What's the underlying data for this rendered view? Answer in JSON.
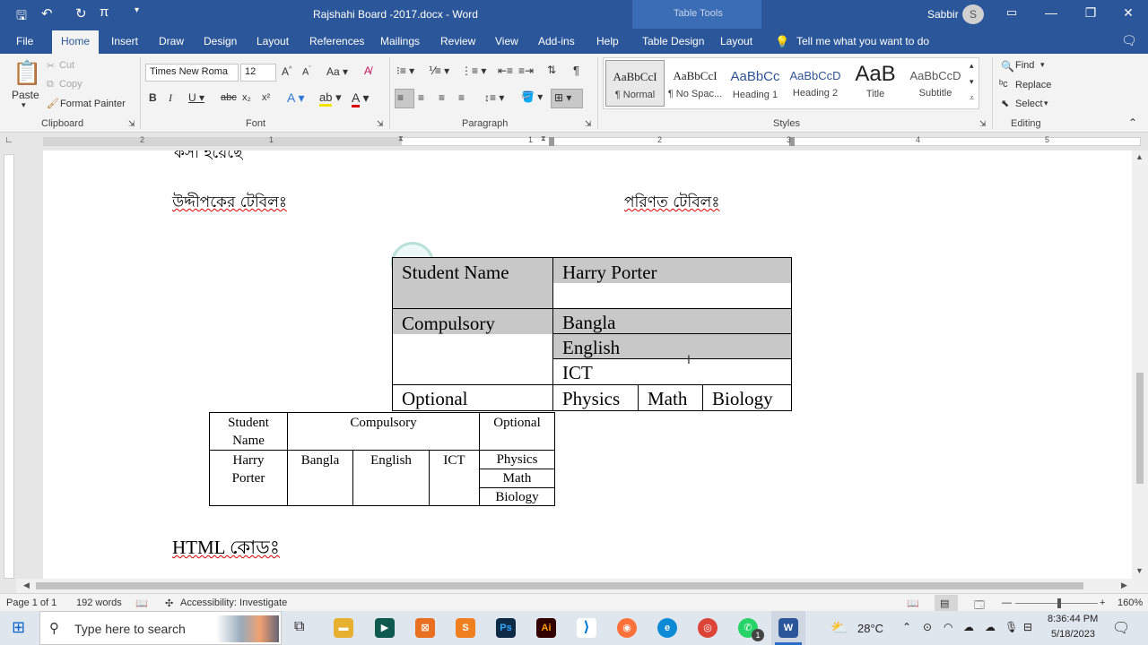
{
  "window": {
    "title": "Rajshahi Board -2017.docx  -  Word",
    "context_tools": "Table Tools",
    "user": "Sabbir",
    "user_initial": "S"
  },
  "tabs": [
    "File",
    "Home",
    "Insert",
    "Draw",
    "Design",
    "Layout",
    "References",
    "Mailings",
    "Review",
    "View",
    "Add-ins",
    "Help",
    "Table Design",
    "Layout"
  ],
  "tellme": "Tell me what you want to do",
  "ribbon": {
    "clipboard": {
      "paste": "Paste",
      "cut": "Cut",
      "copy": "Copy",
      "format_painter": "Format Painter",
      "label": "Clipboard"
    },
    "font": {
      "name": "Times New Roma",
      "size": "12",
      "label": "Font"
    },
    "paragraph": {
      "label": "Paragraph"
    },
    "styles": {
      "label": "Styles",
      "items": [
        {
          "preview": "AaBbCcI",
          "name": "¶ Normal"
        },
        {
          "preview": "AaBbCcI",
          "name": "¶ No Spac..."
        },
        {
          "preview": "AaBbCc",
          "name": "Heading 1"
        },
        {
          "preview": "AaBbCcD",
          "name": "Heading 2"
        },
        {
          "preview": "AaB",
          "name": "Title"
        },
        {
          "preview": "AaBbCcD",
          "name": "Subtitle"
        }
      ]
    },
    "editing": {
      "find": "Find",
      "replace": "Replace",
      "select": "Select",
      "label": "Editing"
    }
  },
  "ruler": {
    "numbers": [
      "2",
      "1",
      "1",
      "1",
      "2",
      "3",
      "4",
      "5"
    ]
  },
  "document": {
    "top_fragment": "কসা হয়েছে",
    "left_heading": "উদ্দীপকের টেবিলঃ",
    "right_heading": "পরিণত টেবিলঃ",
    "table1": {
      "student_name": "Student Name",
      "harry_porter": "Harry Porter",
      "compulsory": "Compulsory",
      "bangla": "Bangla",
      "english": "English",
      "ict": "ICT",
      "optional": "Optional",
      "physics": "Physics",
      "math": "Math",
      "biology": "Biology"
    },
    "table2": {
      "student": "Student",
      "name": "Name",
      "compulsory": "Compulsory",
      "optional": "Optional",
      "harry": "Harry",
      "porter": "Porter",
      "bangla": "Bangla",
      "english": "English",
      "ict": "ICT",
      "physics": "Physics",
      "math": "Math",
      "biology": "Biology"
    },
    "html_heading": "HTML কোডঃ"
  },
  "status": {
    "page": "Page 1 of 1",
    "words": "192 words",
    "accessibility": "Accessibility: Investigate",
    "zoom": "160%"
  },
  "taskbar": {
    "search_placeholder": "Type here to search",
    "temperature": "28°C",
    "time": "8:36:44 PM",
    "date": "5/18/2023",
    "whatsapp_badge": "1",
    "apps": [
      "Ps",
      "Ai",
      "W"
    ]
  }
}
